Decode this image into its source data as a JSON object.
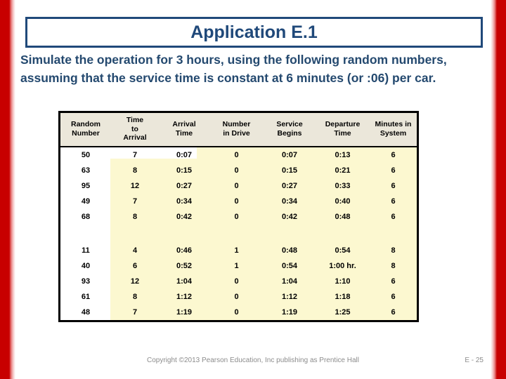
{
  "slide": {
    "title": "Application E.1",
    "body": "Simulate the operation for 3 hours, using the following random numbers, assuming that the service time is constant at 6 minutes (or :06) per car."
  },
  "colors": {
    "accent_red": "#c80000",
    "title_navy": "#20497a",
    "body_navy": "#24496f",
    "header_beige": "#ebe7da",
    "highlight_yellow": "#fcf8d0"
  },
  "table": {
    "headers": [
      "Random Number",
      "Time to Arrival",
      "Arrival Time",
      "Number in Drive",
      "Service Begins",
      "Departure Time",
      "Minutes in System"
    ],
    "header_lines": [
      [
        "Random",
        "Number"
      ],
      [
        "Time",
        "to",
        "Arrival"
      ],
      [
        "Arrival",
        "Time"
      ],
      [
        "Number",
        "in Drive"
      ],
      [
        "Service",
        "Begins"
      ],
      [
        "Departure",
        "Time"
      ],
      [
        "Minutes in",
        "System"
      ]
    ],
    "rows": [
      [
        "50",
        "7",
        "0:07",
        "0",
        "0:07",
        "0:13",
        "6"
      ],
      [
        "63",
        "8",
        "0:15",
        "0",
        "0:15",
        "0:21",
        "6"
      ],
      [
        "95",
        "12",
        "0:27",
        "0",
        "0:27",
        "0:33",
        "6"
      ],
      [
        "49",
        "7",
        "0:34",
        "0",
        "0:34",
        "0:40",
        "6"
      ],
      [
        "68",
        "8",
        "0:42",
        "0",
        "0:42",
        "0:48",
        "6"
      ],
      [
        "11",
        "4",
        "0:46",
        "1",
        "0:48",
        "0:54",
        "8"
      ],
      [
        "40",
        "6",
        "0:52",
        "1",
        "0:54",
        "1:00 hr.",
        "8"
      ],
      [
        "93",
        "12",
        "1:04",
        "0",
        "1:04",
        "1:10",
        "6"
      ],
      [
        "61",
        "8",
        "1:12",
        "0",
        "1:12",
        "1:18",
        "6"
      ],
      [
        "48",
        "7",
        "1:19",
        "0",
        "1:19",
        "1:25",
        "6"
      ]
    ],
    "spacer_after_row_index": 4
  },
  "footer": {
    "copyright": "Copyright ©2013 Pearson Education, Inc  publishing as Prentice Hall",
    "page": "E - 25"
  }
}
